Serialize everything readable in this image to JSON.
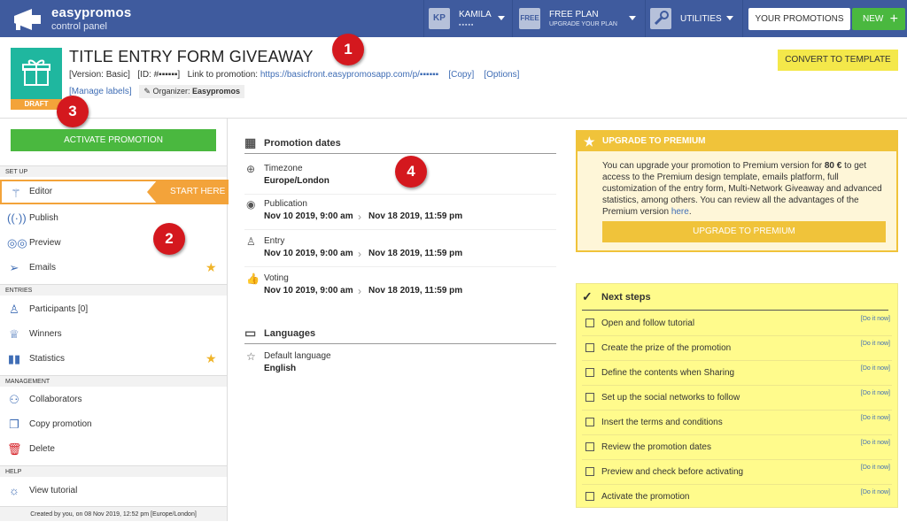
{
  "topbar": {
    "brand": "easypromos",
    "brand_sub": "control panel",
    "user_initials": "KP",
    "user_name": "KAMILA",
    "user_masked": "▪▪▪▪▪",
    "plan_badge": "FREE",
    "plan_name": "FREE PLAN",
    "plan_cta": "UPGRADE YOUR PLAN",
    "utilities_label": "UTILITIES",
    "your_promotions_label": "YOUR PROMOTIONS",
    "new_label": "NEW",
    "new_plus": "+"
  },
  "header": {
    "title": "TITLE ENTRY FORM GIVEAWAY",
    "version": "[Version: Basic]",
    "id_text": "[ID: #▪▪▪▪▪▪]",
    "link_label": "Link to promotion:",
    "link_url": "https://basicfront.easypromosapp.com/p/▪▪▪▪▪▪",
    "copy": "[Copy]",
    "options": "[Options]",
    "manage_labels": "[Manage labels]",
    "organizer_label": "Organizer:",
    "organizer_name": "Easypromos",
    "status_badge": "DRAFT",
    "convert_button": "CONVERT TO TEMPLATE"
  },
  "markers": [
    "1",
    "2",
    "3",
    "4"
  ],
  "sidebar": {
    "activate_button": "ACTIVATE PROMOTION",
    "sections": [
      {
        "label": "SET UP",
        "items": [
          {
            "label": "Editor",
            "icon": "wand-icon",
            "starred": false,
            "active": true
          },
          {
            "label": "Publish",
            "icon": "broadcast-icon",
            "starred": false
          },
          {
            "label": "Preview",
            "icon": "glasses-icon",
            "starred": false
          },
          {
            "label": "Emails",
            "icon": "paper-plane-icon",
            "starred": true
          }
        ]
      },
      {
        "label": "ENTRIES",
        "items": [
          {
            "label": "Participants [0]",
            "icon": "user-icon",
            "starred": false
          },
          {
            "label": "Winners",
            "icon": "trophy-icon",
            "starred": false
          },
          {
            "label": "Statistics",
            "icon": "bar-chart-icon",
            "starred": true
          }
        ]
      },
      {
        "label": "MANAGEMENT",
        "items": [
          {
            "label": "Collaborators",
            "icon": "collaborators-icon",
            "starred": false
          },
          {
            "label": "Copy promotion",
            "icon": "copy-icon",
            "starred": false
          },
          {
            "label": "Delete",
            "icon": "trash-icon",
            "starred": false
          }
        ]
      },
      {
        "label": "HELP",
        "items": [
          {
            "label": "View tutorial",
            "icon": "lightbulb-icon",
            "starred": false
          }
        ]
      }
    ],
    "start_here": "START HERE",
    "footer": "Created by you, on 08 Nov 2019, 12:52 pm [Europe/London]"
  },
  "main": {
    "dates_title": "Promotion dates",
    "timezone_label": "Timezone",
    "timezone_value": "Europe/London",
    "publication_label": "Publication",
    "publication_start": "Nov 10 2019, 9:00 am",
    "publication_end": "Nov 18 2019, 11:59 pm",
    "entry_label": "Entry",
    "entry_start": "Nov 10 2019, 9:00 am",
    "entry_end": "Nov 18 2019, 11:59 pm",
    "voting_label": "Voting",
    "voting_start": "Nov 10 2019, 9:00 am",
    "voting_end": "Nov 18 2019, 11:59 pm",
    "languages_title": "Languages",
    "default_language_label": "Default language",
    "default_language_value": "English"
  },
  "premium": {
    "title": "UPGRADE TO PREMIUM",
    "text_before_price": "You can upgrade your promotion to Premium version for ",
    "price": "80 €",
    "text_after_price": " to get access to the Premium design template, emails platform, full customization of the entry form, Multi-Network Giveaway and advanced statistics, among others. You can review all the advantages of the Premium version ",
    "link": "here",
    "text_end": ".",
    "button": "UPGRADE TO PREMIUM"
  },
  "next_steps": {
    "title": "Next steps",
    "do_it_now": "[Do it now]",
    "items": [
      "Open and follow tutorial",
      "Create the prize of the promotion",
      "Define the contents when Sharing",
      "Set up the social networks to follow",
      "Insert the terms and conditions",
      "Review the promotion dates",
      "Preview and check before activating",
      "Activate the promotion"
    ]
  },
  "colors": {
    "topbar": "#3f5b9e",
    "green": "#4ab83f",
    "orange": "#f3a33a",
    "teal": "#1fb79f",
    "premium_yellow": "#f0c33a",
    "steps_yellow": "#fffb8c",
    "marker_red": "#d4181e"
  }
}
